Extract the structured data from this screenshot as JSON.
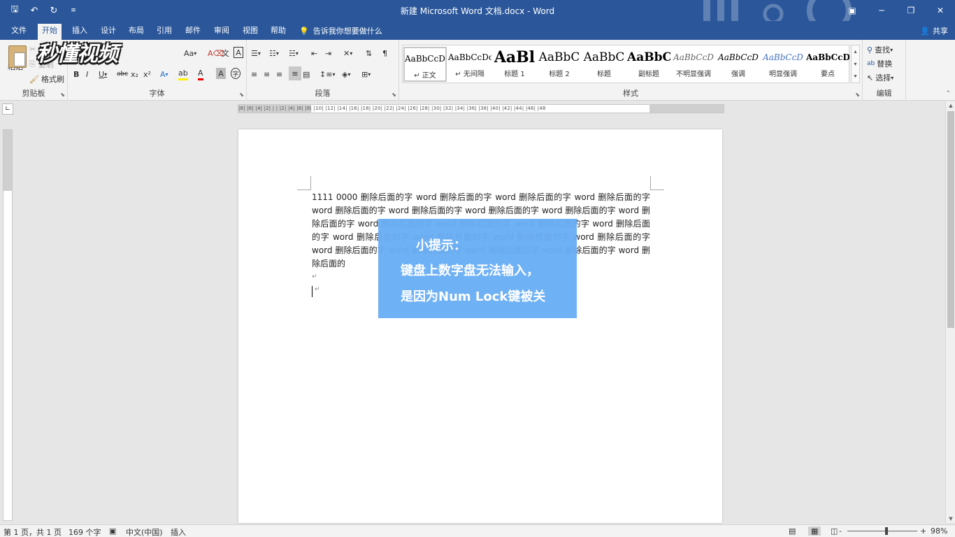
{
  "window": {
    "title": "新建 Microsoft Word 文档.docx  -  Word",
    "qat": {
      "save_icon": "save-icon",
      "undo_icon": "undo-icon",
      "redo_icon": "redo-icon",
      "customize_icon": "customize-icon"
    }
  },
  "tabs": [
    {
      "label": "文件"
    },
    {
      "label": "开始"
    },
    {
      "label": "插入"
    },
    {
      "label": "设计"
    },
    {
      "label": "布局"
    },
    {
      "label": "引用"
    },
    {
      "label": "邮件"
    },
    {
      "label": "审阅"
    },
    {
      "label": "视图"
    },
    {
      "label": "帮助"
    }
  ],
  "active_tab": "开始",
  "tellme": "告诉我你想要做什么",
  "share": "共享",
  "ribbon": {
    "clipboard": {
      "label": "剪贴板",
      "paste": "粘贴",
      "copy": "复制",
      "format_painter": "格式刷"
    },
    "font": {
      "label": "字体",
      "font_size_btn": "Aa"
    },
    "paragraph": {
      "label": "段落"
    },
    "styles": {
      "label": "样式",
      "items": [
        {
          "preview": "AaBbCcDc",
          "name": "↵ 正文"
        },
        {
          "preview": "AaBbCcDc",
          "name": "↵ 无间隔"
        },
        {
          "preview": "AaBl",
          "name": "标题 1"
        },
        {
          "preview": "AaBbC",
          "name": "标题 2"
        },
        {
          "preview": "AaBbC",
          "name": "标题"
        },
        {
          "preview": "AaBbC",
          "name": "副标题"
        },
        {
          "preview": "AaBbCcD",
          "name": "不明显强调"
        },
        {
          "preview": "AaBbCcD",
          "name": "强调"
        },
        {
          "preview": "AaBbCcD",
          "name": "明显强调"
        },
        {
          "preview": "AaBbCcD",
          "name": "要点"
        }
      ]
    },
    "editing": {
      "label": "编辑",
      "find": "查找",
      "replace": "替换",
      "select": "选择"
    }
  },
  "watermark": "秒懂视频",
  "ruler": {
    "marks": "|8| |6| |4| |2| | | |2| |4| |6| |8| |10| |12| |14| |16| |18| |20| |22| |24| |26| |28| |30| |32| |34| |36| |38| |40| |42| |44| |46| |48"
  },
  "document": {
    "text": "1111 0000  删除后面的字 word  删除后面的字 word  删除后面的字 word  删除后面的字 word  删除后面的字 word  删除后面的字 word  删除后面的字 word  删除后面的字 word  删除后面的字 word  删除后面的字 word  删除后面的字 word  删除后面的字 word  删除后面的字 word  删除后面的字 word  删除后面的字 word  删除后面的字 word  删除后面的字 word  删除后面的字 word  删除后面的字 word  删除后面的字 word  删除后面的字 word  删除后面的",
    "paragraph_mark": "↵"
  },
  "tip": {
    "title": "小提示：",
    "line1": "键盘上数字盘无法输入，",
    "line2": "是因为Num Lock键被关"
  },
  "status": {
    "page": "第 1 页，共 1 页",
    "words": "169 个字",
    "language": "中文(中国)",
    "mode": "插入",
    "zoom": "98%",
    "zoom_minus": "-",
    "zoom_plus": "+"
  },
  "colors": {
    "brand": "#2b579a",
    "tip_bg": "#6aaef5"
  }
}
